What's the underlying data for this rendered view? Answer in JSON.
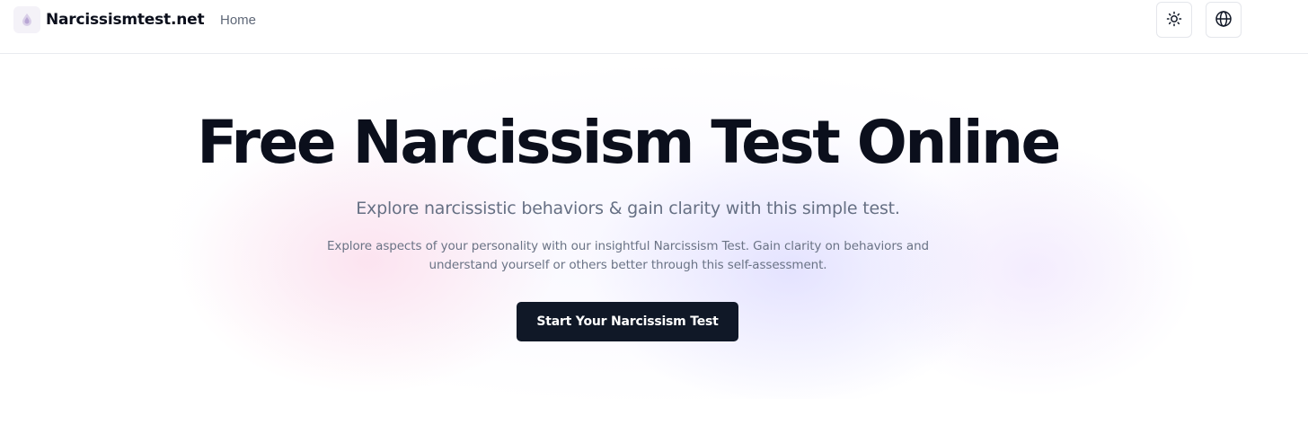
{
  "header": {
    "brand_name": "Narcissismtest.net",
    "nav_home": "Home",
    "icons": {
      "logo": "drop-logo-icon",
      "theme": "sun-icon",
      "language": "globe-icon"
    }
  },
  "hero": {
    "title": "Free Narcissism Test Online",
    "subtitle": "Explore narcissistic behaviors & gain clarity with this simple test.",
    "description": "Explore aspects of your personality with our insightful Narcissism Test. Gain clarity on behaviors and understand yourself or others better through this self-assessment.",
    "cta_label": "Start Your Narcissism Test"
  },
  "colors": {
    "text_primary": "#0b0f1c",
    "text_muted": "#667084",
    "button_bg": "#101827",
    "button_text": "#ffffff",
    "gradient_pink": "#fbcfe3",
    "gradient_blue": "#d2d0ff"
  }
}
